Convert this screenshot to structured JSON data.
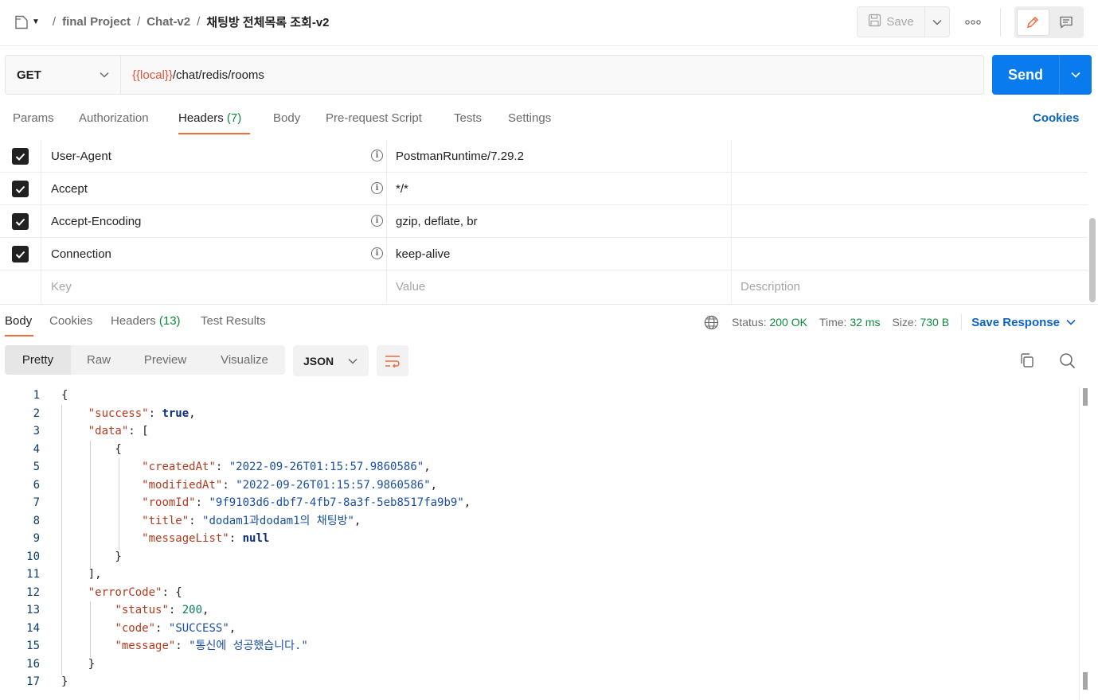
{
  "breadcrumb": {
    "segments": [
      "final Project",
      "Chat-v2"
    ],
    "current": "채팅방 전체목록 조회-v2",
    "separator": "/"
  },
  "toolbar": {
    "save_label": "Save",
    "more_label": "ooo"
  },
  "request": {
    "method": "GET",
    "url_variable": "{{local}}",
    "url_path": "/chat/redis/rooms",
    "send_label": "Send"
  },
  "request_tabs": [
    {
      "label": "Params",
      "count": ""
    },
    {
      "label": "Authorization",
      "count": ""
    },
    {
      "label": "Headers",
      "count": "(7)"
    },
    {
      "label": "Body",
      "count": ""
    },
    {
      "label": "Pre-request Script",
      "count": ""
    },
    {
      "label": "Tests",
      "count": ""
    },
    {
      "label": "Settings",
      "count": ""
    }
  ],
  "cookies_link": "Cookies",
  "headers": [
    {
      "key": "User-Agent",
      "value": "PostmanRuntime/7.29.2",
      "description": ""
    },
    {
      "key": "Accept",
      "value": "*/*",
      "description": ""
    },
    {
      "key": "Accept-Encoding",
      "value": "gzip, deflate, br",
      "description": ""
    },
    {
      "key": "Connection",
      "value": "keep-alive",
      "description": ""
    }
  ],
  "headers_placeholder": {
    "key": "Key",
    "value": "Value",
    "description": "Description"
  },
  "response_tabs": [
    {
      "label": "Body",
      "count": ""
    },
    {
      "label": "Cookies",
      "count": ""
    },
    {
      "label": "Headers",
      "count": "(13)"
    },
    {
      "label": "Test Results",
      "count": ""
    }
  ],
  "response_stats": {
    "status_label": "Status:",
    "status_value": "200 OK",
    "time_label": "Time:",
    "time_value": "32 ms",
    "size_label": "Size:",
    "size_value": "730 B",
    "save_response": "Save Response"
  },
  "view_modes": [
    "Pretty",
    "Raw",
    "Preview",
    "Visualize"
  ],
  "format": "JSON",
  "code_lines": [
    [
      "1",
      "{"
    ],
    [
      "2",
      "    \"success\": true,"
    ],
    [
      "3",
      "    \"data\": ["
    ],
    [
      "4",
      "        {"
    ],
    [
      "5",
      "            \"createdAt\": \"2022-09-26T01:15:57.9860586\","
    ],
    [
      "6",
      "            \"modifiedAt\": \"2022-09-26T01:15:57.9860586\","
    ],
    [
      "7",
      "            \"roomId\": \"9f9103d6-dbf7-4fb7-8a3f-5eb8517fa9b9\","
    ],
    [
      "8",
      "            \"title\": \"dodam1과dodam1의 채팅방\","
    ],
    [
      "9",
      "            \"messageList\": null"
    ],
    [
      "10",
      "        }"
    ],
    [
      "11",
      "    ],"
    ],
    [
      "12",
      "    \"errorCode\": {"
    ],
    [
      "13",
      "        \"status\": 200,"
    ],
    [
      "14",
      "        \"code\": \"SUCCESS\","
    ],
    [
      "15",
      "        \"message\": \"통신에 성공했습니다.\""
    ],
    [
      "16",
      "    }"
    ],
    [
      "17",
      "}"
    ]
  ],
  "colors": {
    "send_blue": "#097bed",
    "tab_underline": "#f26b3a",
    "status_green": "#0f8a3c",
    "url_variable": "#e0533c",
    "json_key": "#b23b1e",
    "json_string": "#1b4fa0"
  },
  "icons": [
    "collection-file-icon",
    "chevron-down-icon",
    "save-disk-icon",
    "more-icon",
    "edit-pencil-icon",
    "comment-icon",
    "info-icon",
    "globe-icon",
    "wrap-lines-icon",
    "copy-icon",
    "search-icon",
    "checkbox-checked-icon"
  ]
}
